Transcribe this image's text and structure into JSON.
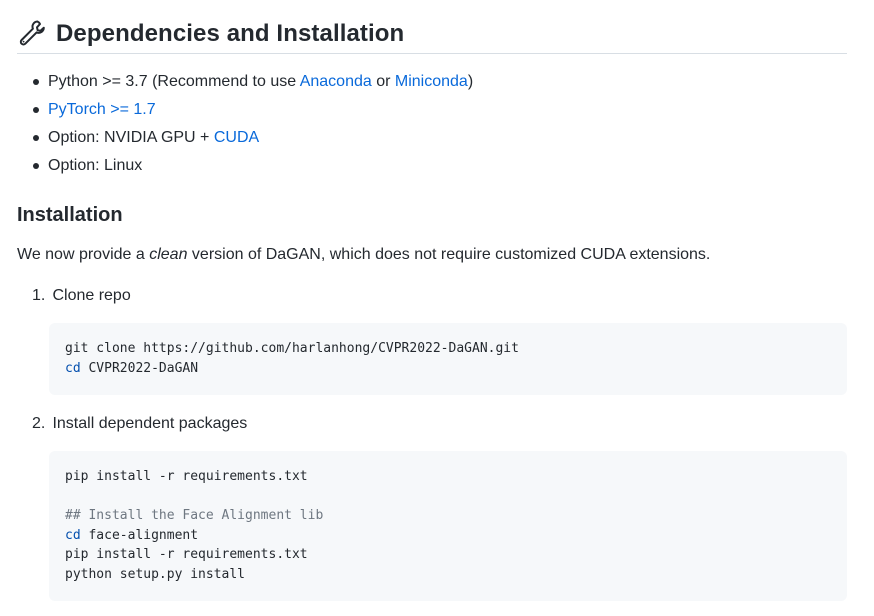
{
  "heading": {
    "icon": "wrench-icon",
    "title": "Dependencies and Installation"
  },
  "dependencies": [
    {
      "parts": [
        {
          "text": "Python >= 3.7 (Recommend to use ",
          "link": false
        },
        {
          "text": "Anaconda",
          "link": true
        },
        {
          "text": " or ",
          "link": false
        },
        {
          "text": "Miniconda",
          "link": true
        },
        {
          "text": ")",
          "link": false
        }
      ]
    },
    {
      "parts": [
        {
          "text": "PyTorch >= 1.7",
          "link": true
        }
      ]
    },
    {
      "parts": [
        {
          "text": "Option: NVIDIA GPU + ",
          "link": false
        },
        {
          "text": "CUDA",
          "link": true
        }
      ]
    },
    {
      "parts": [
        {
          "text": "Option: Linux",
          "link": false
        }
      ]
    }
  ],
  "installation": {
    "title": "Installation",
    "intro_before": "We now provide a ",
    "intro_em": "clean",
    "intro_after": " version of DaGAN, which does not require customized CUDA extensions.",
    "steps": [
      {
        "num": "1.",
        "label": "Clone repo",
        "code": [
          [
            {
              "t": "git clone https://github.com/harlanhong/CVPR2022-DaGAN.git",
              "c": ""
            }
          ],
          [
            {
              "t": "cd",
              "c": "kw"
            },
            {
              "t": " CVPR2022-DaGAN",
              "c": ""
            }
          ]
        ]
      },
      {
        "num": "2.",
        "label": "Install dependent packages",
        "code": [
          [
            {
              "t": "pip install -r requirements.txt",
              "c": ""
            }
          ],
          [
            {
              "t": "",
              "c": ""
            }
          ],
          [
            {
              "t": "## Install the Face Alignment lib",
              "c": "cm"
            }
          ],
          [
            {
              "t": "cd",
              "c": "kw"
            },
            {
              "t": " face-alignment",
              "c": ""
            }
          ],
          [
            {
              "t": "pip install -r requirements.txt",
              "c": ""
            }
          ],
          [
            {
              "t": "python setup.py install",
              "c": ""
            }
          ]
        ]
      }
    ]
  },
  "colors": {
    "link": "#0969da",
    "text": "#24292f",
    "code_bg": "#f6f8fa",
    "keyword": "#0550ae",
    "comment": "#6e7781"
  }
}
